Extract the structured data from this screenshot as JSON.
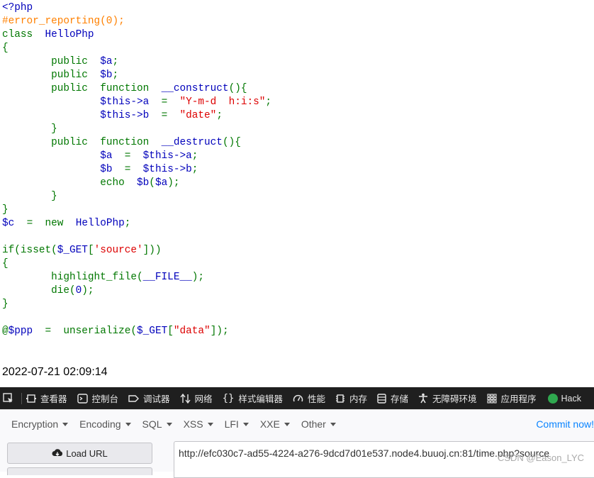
{
  "code": {
    "open_tag": "<?php",
    "comment": "#error_reporting(0);",
    "kw_class": "class",
    "kw_public": "public",
    "kw_function": "function",
    "kw_echo": "echo",
    "kw_new": "new",
    "kw_if": "if",
    "kw_isset": "isset",
    "class_name": "HelloPhp",
    "prop_a": "$a",
    "prop_b": "$b",
    "construct": "__construct",
    "destruct": "__destruct",
    "this_a": "$this->a",
    "this_b": "$this->b",
    "str_format": "\"Y-m-d  h:i:s\"",
    "str_date": "\"date\"",
    "var_c": "$c",
    "get": "$_GET",
    "str_source": "'source'",
    "highlight": "highlight_file",
    "file_const": "__FILE__",
    "die": "die",
    "zero": "0",
    "ppp": "@$ppp",
    "unserialize": "unserialize",
    "str_data": "\"data\"",
    "call_b": "$b"
  },
  "output": {
    "timestamp": "2022-07-21 02:09:14"
  },
  "devtools": {
    "tabs": [
      {
        "label": "查看器",
        "icon": "inspector-icon"
      },
      {
        "label": "控制台",
        "icon": "console-icon"
      },
      {
        "label": "调试器",
        "icon": "debugger-icon"
      },
      {
        "label": "网络",
        "icon": "network-icon"
      },
      {
        "label": "样式编辑器",
        "icon": "style-editor-icon"
      },
      {
        "label": "性能",
        "icon": "performance-icon"
      },
      {
        "label": "内存",
        "icon": "memory-icon"
      },
      {
        "label": "存储",
        "icon": "storage-icon"
      },
      {
        "label": "无障碍环境",
        "icon": "accessibility-icon"
      },
      {
        "label": "应用程序",
        "icon": "application-icon"
      },
      {
        "label": "Hack",
        "icon": "hackbar-icon"
      }
    ]
  },
  "hackbar": {
    "menus": [
      "Encryption",
      "Encoding",
      "SQL",
      "XSS",
      "LFI",
      "XXE",
      "Other"
    ],
    "commit": "Commit now!",
    "load_url": "Load URL",
    "url": "http://efc030c7-ad55-4224-a276-9dcd7d01e537.node4.buuoj.cn:81/time.php?source"
  },
  "watermark": "CSDN @Eason_LYC"
}
